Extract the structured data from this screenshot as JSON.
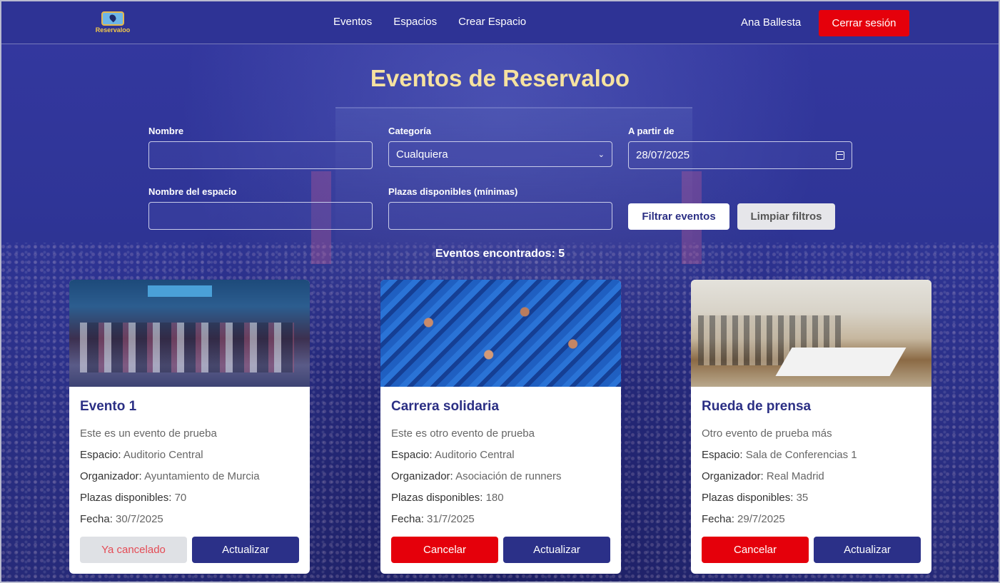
{
  "nav": {
    "logo_text": "Reservaloo",
    "links": [
      "Eventos",
      "Espacios",
      "Crear Espacio"
    ],
    "user": "Ana Ballesta",
    "logout": "Cerrar sesión"
  },
  "title": "Eventos de Reservaloo",
  "filters": {
    "name_label": "Nombre",
    "name_value": "",
    "category_label": "Categoría",
    "category_value": "Cualquiera",
    "from_label": "A partir de",
    "from_value": "28/07/2025",
    "space_label": "Nombre del espacio",
    "space_value": "",
    "seats_label": "Plazas disponibles (mínimas)",
    "seats_value": "",
    "filter_button": "Filtrar eventos",
    "clear_button": "Limpiar filtros"
  },
  "results": "Eventos encontrados: 5",
  "labels": {
    "space": "Espacio:",
    "organizer": "Organizador:",
    "seats": "Plazas disponibles:",
    "date": "Fecha:"
  },
  "events": [
    {
      "title": "Evento 1",
      "description": "Este es un evento de prueba",
      "space": "Auditorio Central",
      "organizer": "Ayuntamiento de Murcia",
      "seats": "70",
      "date": "30/7/2025",
      "cancel_label": "Ya cancelado",
      "update_label": "Actualizar"
    },
    {
      "title": "Carrera solidaria",
      "description": "Este es otro evento de prueba",
      "space": "Auditorio Central",
      "organizer": "Asociación de runners",
      "seats": "180",
      "date": "31/7/2025",
      "cancel_label": "Cancelar",
      "update_label": "Actualizar"
    },
    {
      "title": "Rueda de prensa",
      "description": "Otro evento de prueba más",
      "space": "Sala de Conferencias 1",
      "organizer": "Real Madrid",
      "seats": "35",
      "date": "29/7/2025",
      "cancel_label": "Cancelar",
      "update_label": "Actualizar"
    }
  ],
  "colors": {
    "primary": "#2b3088",
    "danger": "#e5000b",
    "title": "#f6e2a0"
  }
}
